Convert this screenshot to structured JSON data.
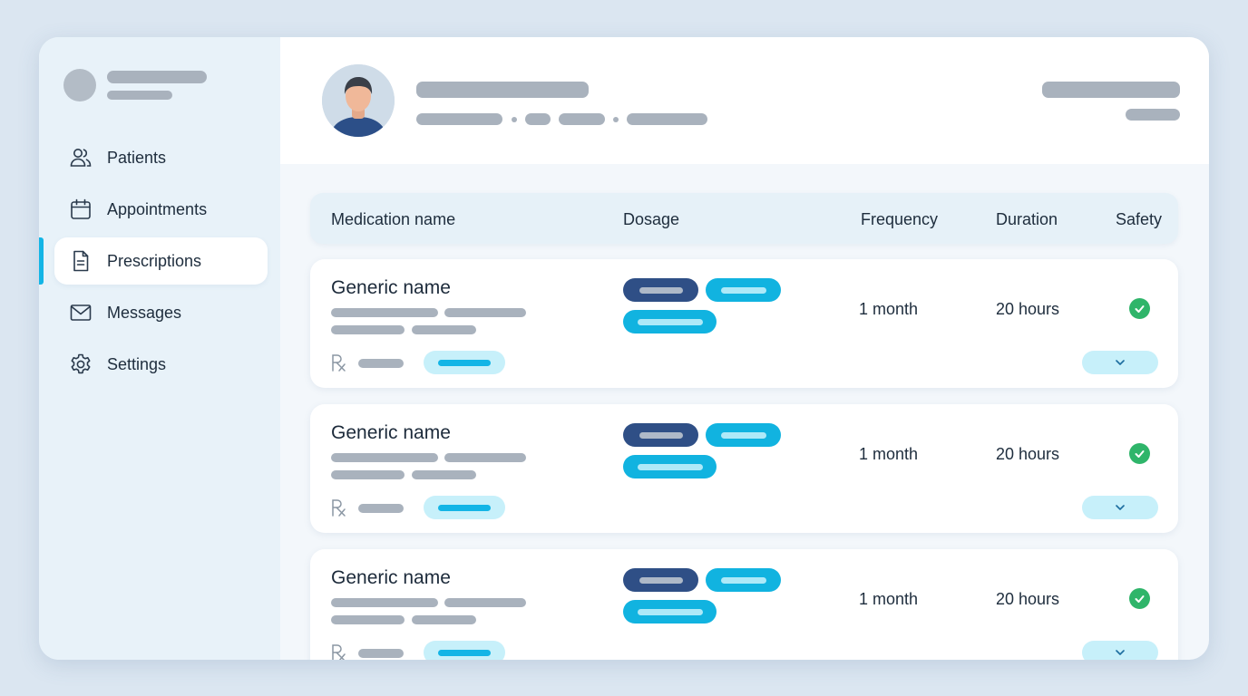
{
  "sidebar": {
    "items": [
      {
        "label": "Patients",
        "icon": "users-icon"
      },
      {
        "label": "Appointments",
        "icon": "calendar-icon"
      },
      {
        "label": "Prescriptions",
        "icon": "document-icon",
        "active": true
      },
      {
        "label": "Messages",
        "icon": "mail-icon"
      },
      {
        "label": "Settings",
        "icon": "gear-icon"
      }
    ]
  },
  "table": {
    "headers": {
      "medication": "Medication name",
      "dosage": "Dosage",
      "frequency": "Frequency",
      "duration": "Duration",
      "safety": "Safety"
    },
    "rows": [
      {
        "name": "Generic name",
        "frequency": "1 month",
        "duration": "20 hours",
        "safety": "check-icon"
      },
      {
        "name": "Generic name",
        "frequency": "1 month",
        "duration": "20 hours",
        "safety": "check-icon"
      },
      {
        "name": "Generic name",
        "frequency": "1 month",
        "duration": "20 hours",
        "safety": "check-icon"
      }
    ]
  },
  "colors": {
    "accent": "#13b5e6",
    "navy_pill": "#2f4f86",
    "cyan_pill": "#11b3e0",
    "safe": "#2fb56a",
    "placeholder": "#a9b2bd"
  }
}
